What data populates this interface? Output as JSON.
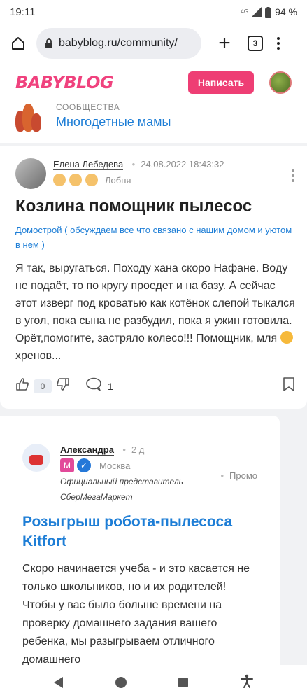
{
  "status_bar": {
    "time": "19:11",
    "network": "4G",
    "battery": "94 %"
  },
  "browser": {
    "url": "babyblog.ru/community/",
    "tab_count": "3"
  },
  "site_header": {
    "logo": "BABYBLOG",
    "write_button": "Написать"
  },
  "community": {
    "label": "СООБЩЕСТВА",
    "name": "Многодетные мамы"
  },
  "post": {
    "author_name": "Елена Лебедева",
    "date": "24.08.2022 18:43:32",
    "location": "Лобня",
    "title": "Козлина помощник пылесос",
    "category": "Домострой ( обсуждаем все что связано с нашим домом и уютом в нем )",
    "text_before_emoji": "Я так, выругаться. Походу хана скоро Нафане. Воду не подаёт, то по кругу проедет и на базу. А сейчас этот изверг под кроватью как котёнок слепой тыкался в угол, пока сына не разбудил, пока я ужин готовила. Орёт,помогите, застряло колесо!!! Помощник, мля",
    "text_after_emoji": "хренов...",
    "likes": "0",
    "comments": "1"
  },
  "promo": {
    "author_name": "Александра",
    "time": "2 д",
    "m_badge": "М",
    "location": "Москва",
    "representative": "Официальный представитель СберМегаМаркет",
    "label": "Промо",
    "title": "Розыгрыш робота-пылесоса Kitfort",
    "text": "Скоро начинается учеба - и это касается не только школьников, но и их родителей! Чтобы у вас было больше времени на проверку домашнего задания вашего ребенка, мы разыгрываем отличного домашнего"
  },
  "colors": {
    "brand_pink": "#ee3e74",
    "link_blue": "#1e7ed6"
  },
  "icons": [
    "home-icon",
    "lock-icon",
    "plus-icon",
    "tabs-icon",
    "menu-icon",
    "thumb-up-icon",
    "thumb-down-icon",
    "comment-icon",
    "bookmark-icon",
    "more-icon",
    "verified-icon",
    "back-icon",
    "home-circle-icon",
    "recents-icon",
    "accessibility-icon"
  ]
}
